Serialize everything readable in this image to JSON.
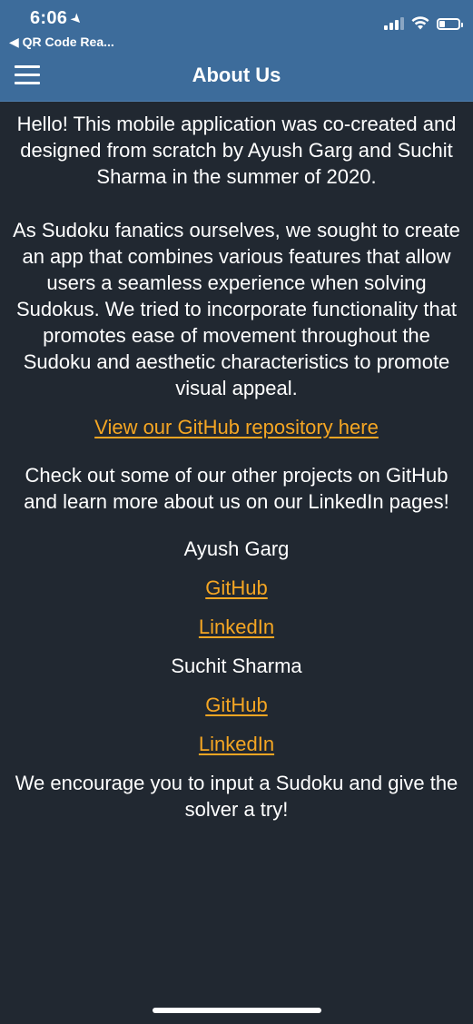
{
  "status_bar": {
    "time": "6:06",
    "back_app": "◀ QR Code Rea..."
  },
  "header": {
    "title": "About Us"
  },
  "content": {
    "intro": "Hello! This mobile application was co-created and designed from scratch by Ayush Garg and Suchit Sharma in the summer of 2020.",
    "mission": "As Sudoku fanatics ourselves, we sought to create an app that combines various features that allow users a seamless experience when solving Sudokus. We tried to incorporate functionality that promotes ease of movement throughout the Sudoku and aesthetic characteristics to promote visual appeal.",
    "repo_link": "View our GitHub repository here",
    "check_out": "Check out some of our other projects on GitHub and learn more about us on our LinkedIn pages!",
    "people": [
      {
        "name": "Ayush Garg",
        "github": "GitHub",
        "linkedin": "LinkedIn"
      },
      {
        "name": "Suchit Sharma",
        "github": "GitHub",
        "linkedin": "LinkedIn"
      }
    ],
    "encourage": "We encourage you to input a Sudoku and give the solver a try!"
  },
  "colors": {
    "header_bg": "#3d6c9b",
    "page_bg": "#212831",
    "link": "#f5a623",
    "text": "#ffffff"
  },
  "icons": {
    "menu": "hamburger-menu-icon",
    "location": "location-arrow-icon",
    "signal": "cellular-signal-icon",
    "wifi": "wifi-icon",
    "battery": "battery-icon"
  }
}
